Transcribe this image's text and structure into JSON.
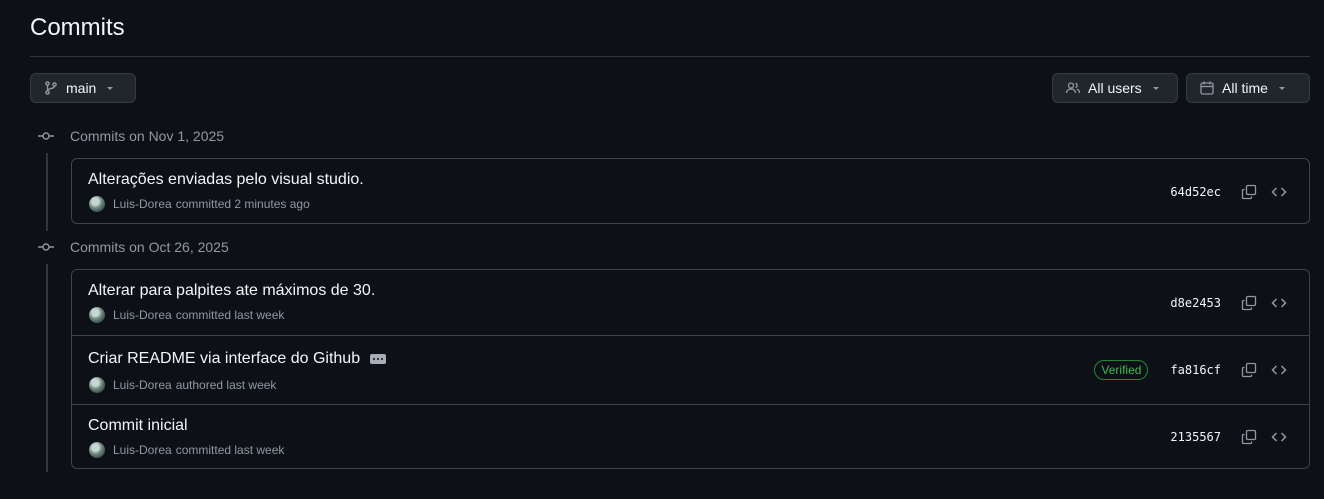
{
  "page": {
    "title": "Commits"
  },
  "toolbar": {
    "branch": {
      "label": "main",
      "icon": "git-branch-icon"
    },
    "users": {
      "label": "All users",
      "icon": "people-icon"
    },
    "time": {
      "label": "All time",
      "icon": "calendar-icon"
    }
  },
  "colors": {
    "background": "#0d1117",
    "border": "#3d444d",
    "muted_text": "#9198a1",
    "verified_green": "#3fb950"
  },
  "groups": [
    {
      "label": "Commits on Nov 1, 2025",
      "commits": [
        {
          "message": "Alterações enviadas pelo visual studio.",
          "author": "Luis-Dorea",
          "action": "committed 2 minutes ago",
          "sha": "64d52ec",
          "verified": ""
        }
      ]
    },
    {
      "label": "Commits on Oct 26, 2025",
      "commits": [
        {
          "message": "Alterar para palpites ate máximos de 30.",
          "author": "Luis-Dorea",
          "action": "committed last week",
          "sha": "d8e2453",
          "verified": ""
        },
        {
          "message": "Criar README via interface do Github",
          "author": "Luis-Dorea",
          "action": "authored last week",
          "sha": "fa816cf",
          "verified": "Verified"
        },
        {
          "message": "Commit inicial",
          "author": "Luis-Dorea",
          "action": "committed last week",
          "sha": "2135567",
          "verified": ""
        }
      ]
    }
  ]
}
